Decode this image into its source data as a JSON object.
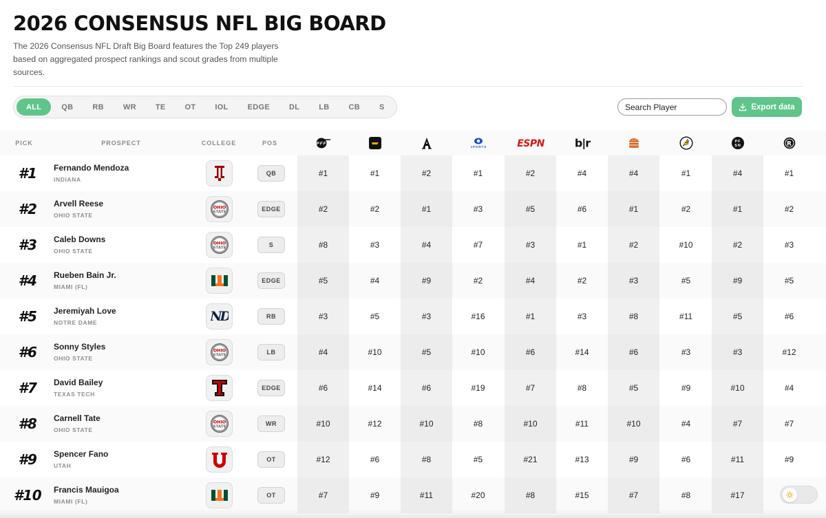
{
  "header": {
    "title": "2026 CONSENSUS NFL BIG BOARD",
    "description": "The 2026 Consensus NFL Draft Big Board features the Top 249 players based on aggregated prospect rankings and scout grades from multiple sources."
  },
  "filters": [
    "ALL",
    "QB",
    "RB",
    "WR",
    "TE",
    "OT",
    "IOL",
    "EDGE",
    "DL",
    "LB",
    "CB",
    "S"
  ],
  "active_filter": "ALL",
  "search": {
    "placeholder": "Search Player"
  },
  "export": {
    "label": "Export data"
  },
  "columns": {
    "pick": "PICK",
    "prospect": "PROSPECT",
    "college": "COLLEGE",
    "pos": "POS",
    "sources": [
      {
        "icon": "pff-logo-icon",
        "text": "PFF"
      },
      {
        "icon": "dk-logo-icon",
        "text": ""
      },
      {
        "icon": "athletic-logo-icon",
        "text": "A"
      },
      {
        "icon": "cbs-sports-logo-icon",
        "text": "SPORTS"
      },
      {
        "icon": "espn-logo-icon",
        "text": "ESPN"
      },
      {
        "icon": "bleacher-report-logo-icon",
        "text": "b|r"
      },
      {
        "icon": "burger-logo-icon",
        "text": ""
      },
      {
        "icon": "bird-logo-icon",
        "text": ""
      },
      {
        "icon": "pfsn-logo-icon",
        "text": "PF SN"
      },
      {
        "icon": "ringer-logo-icon",
        "text": "R"
      }
    ]
  },
  "colors": {
    "accent": "#5fc58a",
    "espn_red": "#d21a1a",
    "indiana": "#990000",
    "ohio_state": "#bb0000",
    "miami_green": "#005030",
    "miami_orange": "#f47321",
    "notre_dame": "#0c2340",
    "texas_tech": "#cc0000",
    "utah": "#cc0000"
  },
  "rows": [
    {
      "pick": "#1",
      "name": "Fernando Mendoza",
      "college": "INDIANA",
      "college_logo": "indiana",
      "pos": "QB",
      "ranks": [
        "#1",
        "#1",
        "#2",
        "#1",
        "#2",
        "#4",
        "#4",
        "#1",
        "#4",
        "#1"
      ]
    },
    {
      "pick": "#2",
      "name": "Arvell Reese",
      "college": "OHIO STATE",
      "college_logo": "ohio-state",
      "pos": "EDGE",
      "ranks": [
        "#2",
        "#2",
        "#1",
        "#3",
        "#5",
        "#6",
        "#1",
        "#2",
        "#1",
        "#2"
      ]
    },
    {
      "pick": "#3",
      "name": "Caleb Downs",
      "college": "OHIO STATE",
      "college_logo": "ohio-state",
      "pos": "S",
      "ranks": [
        "#8",
        "#3",
        "#4",
        "#7",
        "#3",
        "#1",
        "#2",
        "#10",
        "#2",
        "#3"
      ]
    },
    {
      "pick": "#4",
      "name": "Rueben Bain Jr.",
      "college": "MIAMI (FL)",
      "college_logo": "miami",
      "pos": "EDGE",
      "ranks": [
        "#5",
        "#4",
        "#9",
        "#2",
        "#4",
        "#2",
        "#3",
        "#5",
        "#9",
        "#5"
      ]
    },
    {
      "pick": "#5",
      "name": "Jeremiyah Love",
      "college": "NOTRE DAME",
      "college_logo": "notre-dame",
      "pos": "RB",
      "ranks": [
        "#3",
        "#5",
        "#3",
        "#16",
        "#1",
        "#3",
        "#8",
        "#11",
        "#5",
        "#6"
      ]
    },
    {
      "pick": "#6",
      "name": "Sonny Styles",
      "college": "OHIO STATE",
      "college_logo": "ohio-state",
      "pos": "LB",
      "ranks": [
        "#4",
        "#10",
        "#5",
        "#10",
        "#6",
        "#14",
        "#6",
        "#3",
        "#3",
        "#12"
      ]
    },
    {
      "pick": "#7",
      "name": "David Bailey",
      "college": "TEXAS TECH",
      "college_logo": "texas-tech",
      "pos": "EDGE",
      "ranks": [
        "#6",
        "#14",
        "#6",
        "#19",
        "#7",
        "#8",
        "#5",
        "#9",
        "#10",
        "#4"
      ]
    },
    {
      "pick": "#8",
      "name": "Carnell Tate",
      "college": "OHIO STATE",
      "college_logo": "ohio-state",
      "pos": "WR",
      "ranks": [
        "#10",
        "#12",
        "#10",
        "#8",
        "#10",
        "#11",
        "#10",
        "#4",
        "#7",
        "#7"
      ]
    },
    {
      "pick": "#9",
      "name": "Spencer Fano",
      "college": "UTAH",
      "college_logo": "utah",
      "pos": "OT",
      "ranks": [
        "#12",
        "#6",
        "#8",
        "#5",
        "#21",
        "#13",
        "#9",
        "#6",
        "#11",
        "#9"
      ]
    },
    {
      "pick": "#10",
      "name": "Francis Mauigoa",
      "college": "MIAMI (FL)",
      "college_logo": "miami",
      "pos": "OT",
      "ranks": [
        "#7",
        "#9",
        "#11",
        "#20",
        "#8",
        "#15",
        "#7",
        "#8",
        "#17",
        ""
      ]
    }
  ]
}
